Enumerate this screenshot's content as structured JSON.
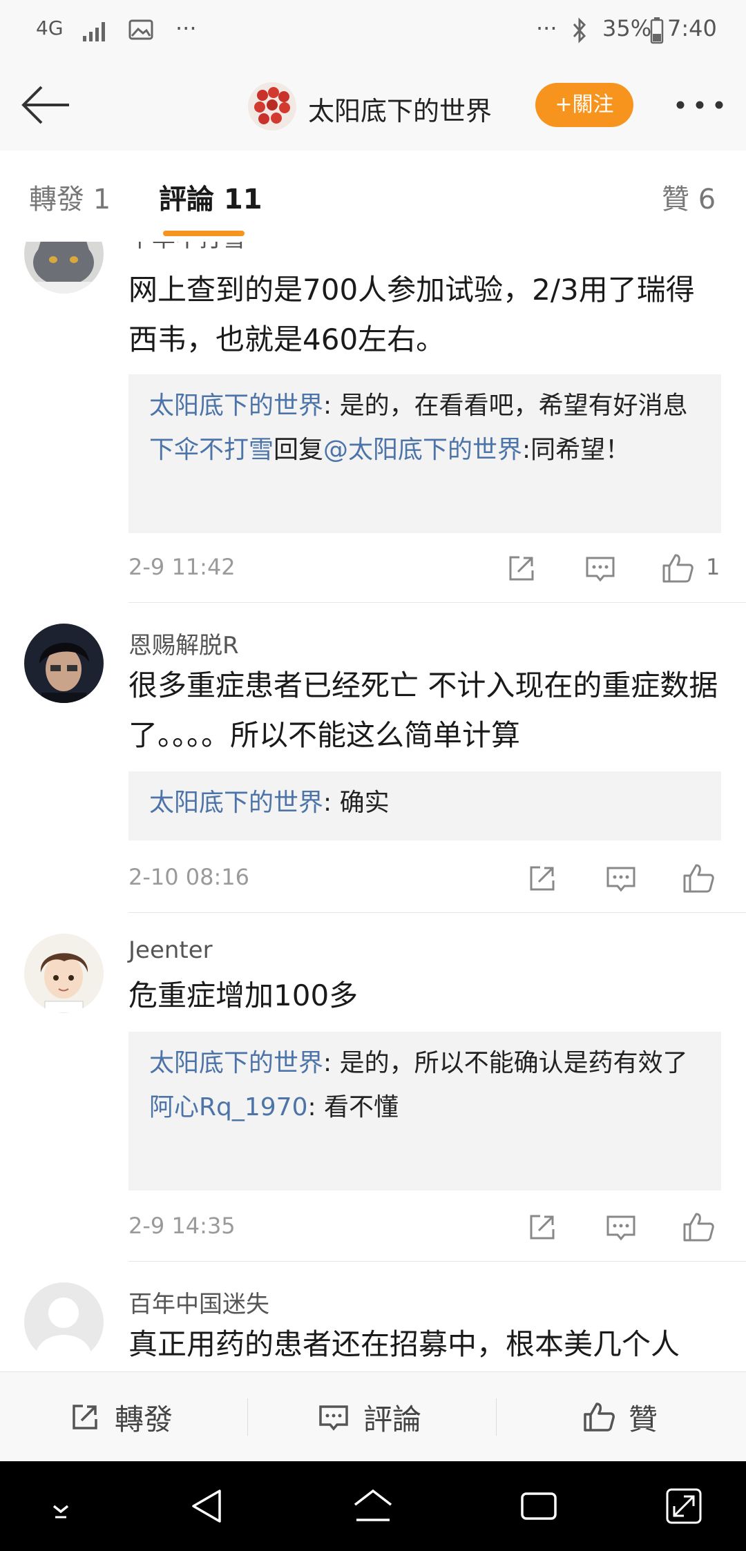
{
  "status_bar": {
    "network": "4G",
    "battery": "35%",
    "time": "7:40"
  },
  "header": {
    "account_name": "太阳底下的世界",
    "follow_label": "+關注"
  },
  "tabs": {
    "repost": "轉發 1",
    "comments": "評論 11",
    "likes": "贊 6"
  },
  "comments": [
    {
      "username": "下伞不打雪",
      "text": "网上查到的是700人参加试验，2/3用了瑞得西韦，也就是460左右。",
      "replies": [
        {
          "name": "太阳底下的世界",
          "text": ": 是的，在看看吧，希望有好消息"
        },
        {
          "name": "下伞不打雪",
          "mid": "回复",
          "mention": "@太阳底下的世界",
          "text": ":同希望！"
        }
      ],
      "time": "2-9 11:42",
      "likes": "1"
    },
    {
      "username": "恩赐解脱R",
      "text": "很多重症患者已经死亡  不计入现在的重症数据了。。。。所以不能这么简单计算",
      "replies": [
        {
          "name": "太阳底下的世界",
          "text": ": 确实"
        }
      ],
      "time": "2-10 08:16",
      "likes": ""
    },
    {
      "username": "Jeenter",
      "text": "危重症增加100多",
      "replies": [
        {
          "name": "太阳底下的世界",
          "text": ": 是的，所以不能确认是药有效了"
        },
        {
          "name": "阿心Rq_1970",
          "text": ": 看不懂"
        }
      ],
      "time": "2-9 14:35",
      "likes": ""
    },
    {
      "username": "百年中国迷失",
      "text": "真正用药的患者还在招募中，根本美几个人"
    }
  ],
  "bottom_bar": {
    "repost": "轉發",
    "comment": "評論",
    "like": "贊"
  },
  "colors": {
    "accent": "#f7941d",
    "link": "#4d74a8"
  }
}
